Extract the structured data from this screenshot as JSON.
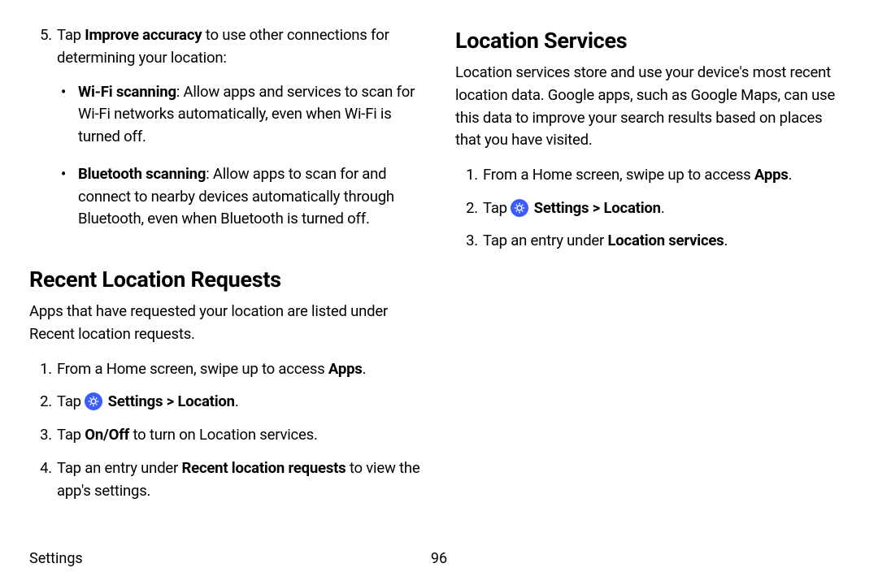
{
  "colors": {
    "icon_blue": "#3b5cff"
  },
  "left": {
    "item5": {
      "num": "5.",
      "pre": "Tap ",
      "bold": "Improve accuracy",
      "post": " to use other connections for determining your location:"
    },
    "bullets": [
      {
        "bold": "Wi-Fi scanning",
        "rest": ": Allow apps and services to scan for Wi-Fi networks automatically, even when Wi-Fi is turned off."
      },
      {
        "bold": "Bluetooth scanning",
        "rest": ": Allow apps to scan for and connect to nearby devices automatically through Bluetooth, even when Bluetooth is turned off."
      }
    ],
    "heading": "Recent Location Requests",
    "para": "Apps that have requested your location are listed under Recent location requests.",
    "steps": {
      "s1": {
        "num": "1.",
        "pre": "From a Home screen, swipe up to access ",
        "bold": "Apps",
        "post": "."
      },
      "s2": {
        "num": "2.",
        "pre": "Tap ",
        "b1": "Settings",
        "gt": " > ",
        "b2": "Location",
        "post": "."
      },
      "s3": {
        "num": "3.",
        "pre": "Tap ",
        "bold": "On/Off",
        "post": " to turn on Location services."
      },
      "s4": {
        "num": "4.",
        "pre": "Tap an entry under ",
        "bold": "Recent location requests",
        "post": " to view the app's settings."
      }
    }
  },
  "right": {
    "heading": "Location Services",
    "para": "Location services store and use your device's most recent location data. Google apps, such as Google Maps, can use this data to improve your search results based on places that you have visited.",
    "steps": {
      "s1": {
        "num": "1.",
        "pre": "From a Home screen, swipe up to access ",
        "bold": "Apps",
        "post": "."
      },
      "s2": {
        "num": "2.",
        "pre": "Tap ",
        "b1": "Settings",
        "gt": " > ",
        "b2": "Location",
        "post": "."
      },
      "s3": {
        "num": "3.",
        "pre": "Tap an entry under ",
        "bold": "Location services",
        "post": "."
      }
    }
  },
  "footer": {
    "label": "Settings",
    "page": "96"
  }
}
